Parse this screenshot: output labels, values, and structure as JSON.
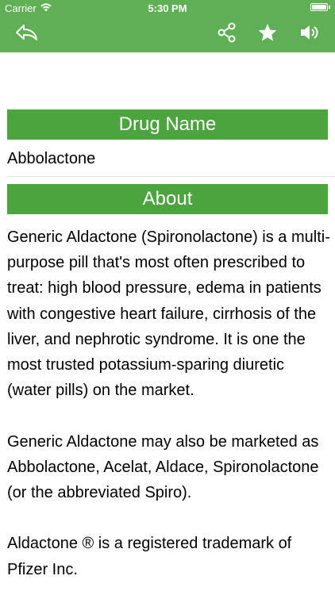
{
  "status_bar": {
    "carrier": "Carrier",
    "time": "5:30 PM",
    "battery_icon": "battery-full-icon",
    "wifi_icon": "wifi-icon"
  },
  "nav_bar": {
    "background_color": "#5faf55",
    "back_icon": "back-arrow-icon",
    "share_icon": "share-icon",
    "favorite_icon": "star-icon",
    "speak_icon": "speaker-icon"
  },
  "drug_section": {
    "header": "Drug Name",
    "value": "Abbolactone"
  },
  "about_section": {
    "header": "About",
    "text": "Generic Aldactone (Spironolactone) is a multi-purpose pill that's most often prescribed to treat: high blood pressure, edema in patients with congestive heart failure, cirrhosis of the liver, and nephrotic syndrome. It is one the most trusted potassium-sparing diuretic (water pills) on the market.\n\nGeneric Aldactone may also be marketed as Abbolactone, Acelat, Aldace, Spironolactone (or the abbreviated Spiro).\n\nAldactone ® is a registered trademark of Pfizer Inc."
  },
  "colors": {
    "accent": "#4ca43f",
    "nav": "#5faf55"
  }
}
